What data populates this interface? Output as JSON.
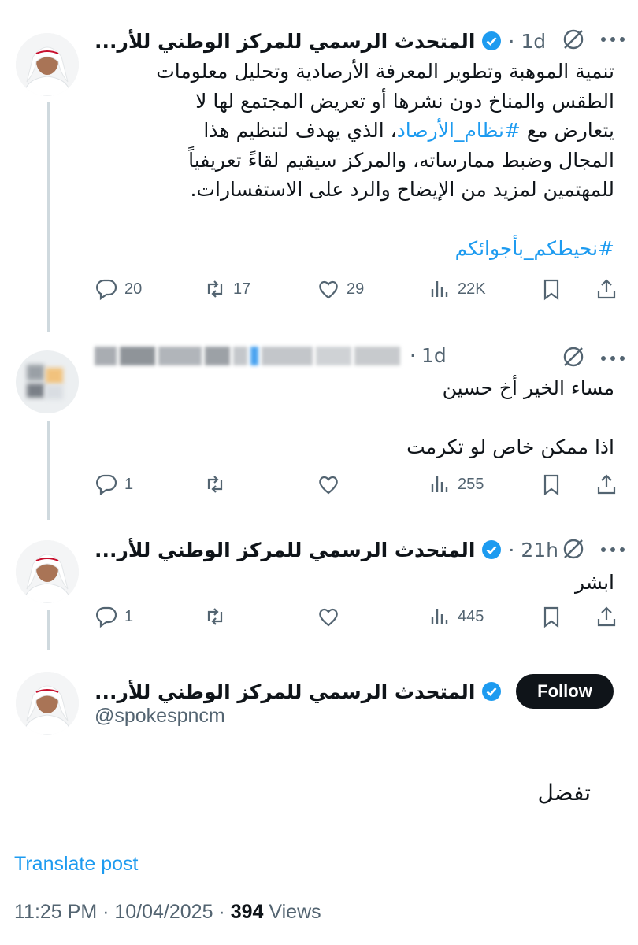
{
  "main_tweet": {
    "author": "المتحدث الرسمي للمركز الوطني للأر...",
    "time": "1d",
    "lines": [
      "تنمية الموهبة وتطوير المعرفة الأرصادية وتحليل معلومات",
      "الطقس والمناخ دون نشرها أو تعريض المجتمع لها لا",
      "الذي يهدف لتنظيم هذا",
      "المجال وضبط ممارساته، والمركز سيقيم لقاءً تعريفياً",
      "للمهتمين لمزيد من الإيضاح والرد على الاستفسارات."
    ],
    "line3_prefix": "يتعارض مع ",
    "line3_hashtag": "#نظام_الأرصاد",
    "line3_suffix": "، ",
    "hashtag_line": "#نحيطكم_بأجوائكم",
    "replies": "20",
    "reposts": "17",
    "likes": "29",
    "views": "22K"
  },
  "reply_tweet": {
    "time": "1d",
    "line1": "مساء الخير أخ حسين",
    "line2": "اذا ممكن خاص لو تكرمت",
    "replies": "1",
    "reposts": "",
    "likes": "",
    "views": "255"
  },
  "answer_tweet": {
    "author": "المتحدث الرسمي للمركز الوطني للأر...",
    "time": "21h",
    "text": "ابشر",
    "replies": "1",
    "reposts": "",
    "likes": "",
    "views": "445"
  },
  "focused_tweet": {
    "author": "المتحدث الرسمي للمركز الوطني للأر...",
    "handle": "@spokespncm",
    "follow_label": "Follow",
    "text": "تفضل",
    "translate_label": "Translate post",
    "time": "11:25 PM · 10/04/2025 · ",
    "views_count": "394",
    "views_label": " Views"
  },
  "colors": {
    "text": "#0f1419",
    "secondary": "#536471",
    "accent": "#1d9bf0",
    "thread_line": "#cfd9de"
  },
  "icons": [
    "more-icon",
    "grok-icon",
    "verified-icon",
    "reply-icon",
    "repost-icon",
    "like-icon",
    "views-icon",
    "bookmark-icon",
    "share-icon"
  ]
}
